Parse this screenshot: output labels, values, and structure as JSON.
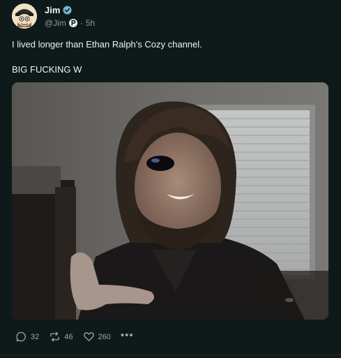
{
  "author": {
    "display_name": "Jim",
    "handle": "@Jim",
    "timestamp": "5h",
    "separator": "·",
    "verified_icon": "verified-check-icon",
    "badge_icon": "p-badge-icon"
  },
  "post": {
    "lines": [
      "I lived longer than Ethan Ralph's Cozy channel.",
      "BIG FUCKING W"
    ]
  },
  "actions": {
    "replies": "32",
    "reposts": "46",
    "likes": "260",
    "more": "•••"
  },
  "colors": {
    "background": "#0e1a1a",
    "verified": "#6fb8c8",
    "muted": "#8a9a9a"
  }
}
